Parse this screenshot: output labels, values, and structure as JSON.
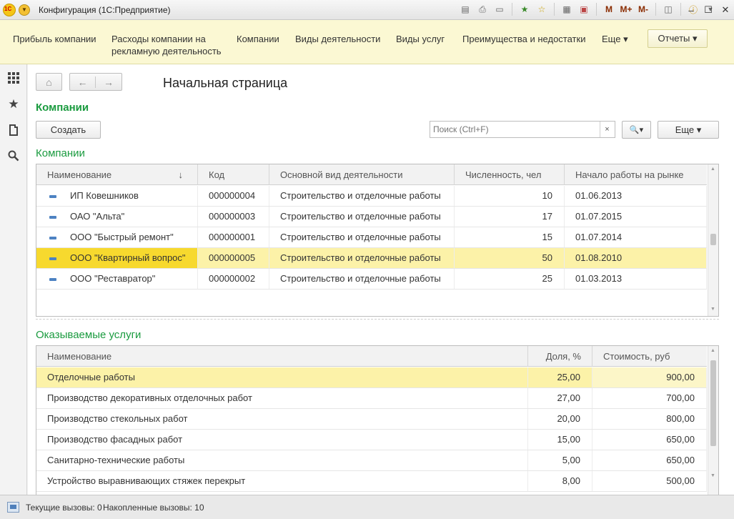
{
  "window": {
    "title": "Конфигурация  (1С:Предприятие)",
    "m_labels": [
      "M",
      "M+",
      "M-"
    ]
  },
  "mainnav": {
    "items": [
      {
        "label": "Прибыль компании"
      },
      {
        "label": "Расходы компании на рекламную деятельность"
      },
      {
        "label": "Компании"
      },
      {
        "label": "Виды деятельности"
      },
      {
        "label": "Виды услуг"
      },
      {
        "label": "Преимущества и недостатки"
      },
      {
        "label": "Еще ▾"
      }
    ],
    "reports_label": "Отчеты ▾"
  },
  "page": {
    "title": "Начальная страница",
    "section_title": "Компании",
    "create_label": "Создать",
    "search_placeholder": "Поиск (Ctrl+F)",
    "search_btn_label": "🔍▾",
    "more_label": "Еще ▾"
  },
  "companies": {
    "label": "Компании",
    "columns": [
      "Наименование",
      "Код",
      "Основной вид деятельности",
      "Численность, чел",
      "Начало работы на рынке"
    ],
    "sort_indicator": "↓",
    "rows": [
      {
        "name": "ИП Ковешников",
        "code": "000000004",
        "activity": "Строительство и отделочные работы",
        "staff": "10",
        "start": "01.06.2013"
      },
      {
        "name": "ОАО \"Альта\"",
        "code": "000000003",
        "activity": "Строительство и отделочные работы",
        "staff": "17",
        "start": "01.07.2015"
      },
      {
        "name": "ООО \"Быстрый ремонт\"",
        "code": "000000001",
        "activity": "Строительство и отделочные работы",
        "staff": "15",
        "start": "01.07.2014"
      },
      {
        "name": "ООО \"Квартирный вопрос\"",
        "code": "000000005",
        "activity": "Строительство и отделочные работы",
        "staff": "50",
        "start": "01.08.2010"
      },
      {
        "name": "ООО \"Реставратор\"",
        "code": "000000002",
        "activity": "Строительство и отделочные работы",
        "staff": "25",
        "start": "01.03.2013"
      }
    ]
  },
  "services": {
    "label": "Оказываемые услуги",
    "columns": [
      "Наименование",
      "Доля, %",
      "Стоимость, руб"
    ],
    "rows": [
      {
        "name": "Отделочные работы",
        "share": "25,00",
        "cost": "900,00"
      },
      {
        "name": "Производство декоративных отделочных работ",
        "share": "27,00",
        "cost": "700,00"
      },
      {
        "name": "Производство стекольных работ",
        "share": "20,00",
        "cost": "800,00"
      },
      {
        "name": "Производство фасадных работ",
        "share": "15,00",
        "cost": "650,00"
      },
      {
        "name": "Санитарно-технические работы",
        "share": "5,00",
        "cost": "650,00"
      },
      {
        "name": "Устройство выравнивающих стяжек перекрыт",
        "share": "8,00",
        "cost": "500,00"
      }
    ]
  },
  "status": {
    "current_calls": "Текущие вызовы: 0",
    "accum_calls": "Накопленные вызовы: 10"
  }
}
